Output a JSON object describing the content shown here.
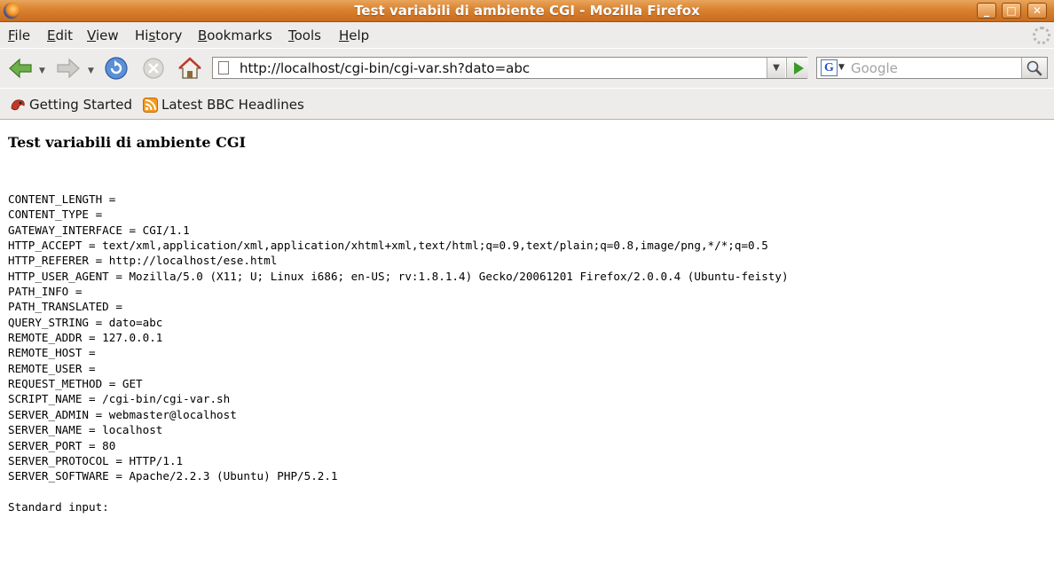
{
  "window": {
    "title": "Test variabili di ambiente CGI - Mozilla Firefox",
    "min_glyph": "_",
    "max_glyph": "□",
    "close_glyph": "✕"
  },
  "menu": {
    "items": [
      {
        "label": "File",
        "mnemonic": "F",
        "rest": "ile"
      },
      {
        "label": "Edit",
        "mnemonic": "E",
        "rest": "dit"
      },
      {
        "label": "View",
        "mnemonic": "V",
        "rest": "iew"
      },
      {
        "label": "History",
        "pre": "Hi",
        "mnemonic": "s",
        "rest": "tory"
      },
      {
        "label": "Bookmarks",
        "mnemonic": "B",
        "rest": "ookmarks"
      },
      {
        "label": "Tools",
        "mnemonic": "T",
        "rest": "ools"
      },
      {
        "label": "Help",
        "mnemonic": "H",
        "rest": "elp"
      }
    ]
  },
  "navigation": {
    "url": "http://localhost/cgi-bin/cgi-var.sh?dato=abc",
    "search_placeholder": "Google",
    "icons": {
      "back": "back-arrow-icon",
      "forward": "forward-arrow-icon",
      "reload": "reload-icon",
      "stop": "stop-icon",
      "home": "home-icon",
      "go": "go-arrow-icon",
      "search": "magnifier-icon"
    }
  },
  "bookmarks": {
    "items": [
      {
        "label": "Getting Started",
        "icon": "firefox-bookmark-icon"
      },
      {
        "label": "Latest BBC Headlines",
        "icon": "rss-feed-icon"
      }
    ]
  },
  "page": {
    "heading": "Test variabili di ambiente CGI",
    "env": [
      "CONTENT_LENGTH =",
      "CONTENT_TYPE =",
      "GATEWAY_INTERFACE = CGI/1.1",
      "HTTP_ACCEPT = text/xml,application/xml,application/xhtml+xml,text/html;q=0.9,text/plain;q=0.8,image/png,*/*;q=0.5",
      "HTTP_REFERER = http://localhost/ese.html",
      "HTTP_USER_AGENT = Mozilla/5.0 (X11; U; Linux i686; en-US; rv:1.8.1.4) Gecko/20061201 Firefox/2.0.0.4 (Ubuntu-feisty)",
      "PATH_INFO =",
      "PATH_TRANSLATED =",
      "QUERY_STRING = dato=abc",
      "REMOTE_ADDR = 127.0.0.1",
      "REMOTE_HOST =",
      "REMOTE_USER =",
      "REQUEST_METHOD = GET",
      "SCRIPT_NAME = /cgi-bin/cgi-var.sh",
      "SERVER_ADMIN = webmaster@localhost",
      "SERVER_NAME = localhost",
      "SERVER_PORT = 80",
      "SERVER_PROTOCOL = HTTP/1.1",
      "SERVER_SOFTWARE = Apache/2.2.3 (Ubuntu) PHP/5.2.1"
    ],
    "stdin_label": "Standard input:"
  }
}
